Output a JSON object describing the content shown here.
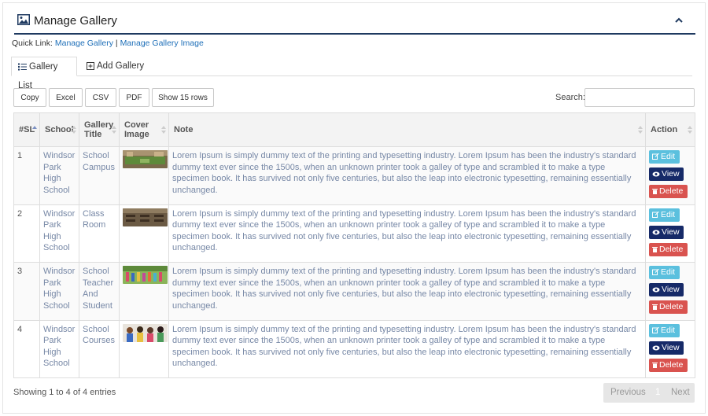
{
  "header": {
    "title": "Manage Gallery"
  },
  "quicklinks": {
    "prefix": "Quick Link:",
    "link1": "Manage Gallery",
    "separator": "|",
    "link2": "Manage Gallery Image"
  },
  "tabs": [
    {
      "label": "Gallery List"
    },
    {
      "label": "Add Gallery"
    }
  ],
  "toolbar": {
    "copy": "Copy",
    "excel": "Excel",
    "csv": "CSV",
    "pdf": "PDF",
    "show_rows": "Show 15 rows",
    "search_label": "Search:",
    "search_value": ""
  },
  "table": {
    "columns": [
      "#SL",
      "School",
      "Gallery Title",
      "Cover Image",
      "Note",
      "Action"
    ],
    "rows": [
      {
        "sl": "1",
        "school": "Windsor Park High School",
        "title": "School Campus",
        "image": "campus-photo",
        "note": "Lorem Ipsum is simply dummy text of the printing and typesetting industry. Lorem Ipsum has been the industry's standard dummy text ever since the 1500s, when an unknown printer took a galley of type and scrambled it to make a type specimen book. It has survived not only five centuries, but also the leap into electronic typesetting, remaining essentially unchanged."
      },
      {
        "sl": "2",
        "school": "Windsor Park High School",
        "title": "Class Room",
        "image": "classroom-photo",
        "note": "Lorem Ipsum is simply dummy text of the printing and typesetting industry. Lorem Ipsum has been the industry's standard dummy text ever since the 1500s, when an unknown printer took a galley of type and scrambled it to make a type specimen book. It has survived not only five centuries, but also the leap into electronic typesetting, remaining essentially unchanged."
      },
      {
        "sl": "3",
        "school": "Windsor Park High School",
        "title": "School Teacher And Student",
        "image": "students-photo",
        "note": "Lorem Ipsum is simply dummy text of the printing and typesetting industry. Lorem Ipsum has been the industry's standard dummy text ever since the 1500s, when an unknown printer took a galley of type and scrambled it to make a type specimen book. It has survived not only five centuries, but also the leap into electronic typesetting, remaining essentially unchanged."
      },
      {
        "sl": "4",
        "school": "Windsor Park High School",
        "title": "School Courses",
        "image": "courses-photo",
        "note": "Lorem Ipsum is simply dummy text of the printing and typesetting industry. Lorem Ipsum has been the industry's standard dummy text ever since the 1500s, when an unknown printer took a galley of type and scrambled it to make a type specimen book. It has survived not only five centuries, but also the leap into electronic typesetting, remaining essentially unchanged."
      }
    ],
    "actions": {
      "edit": "Edit",
      "view": "View",
      "delete": "Delete"
    }
  },
  "footer": {
    "info": "Showing 1 to 4 of 4 entries",
    "previous": "Previous",
    "page": "1",
    "next": "Next"
  },
  "colors": {
    "accent": "#1f3a60",
    "link": "#1e6fb8",
    "edit": "#5bc0de",
    "view": "#162a68",
    "delete": "#d9534f"
  }
}
